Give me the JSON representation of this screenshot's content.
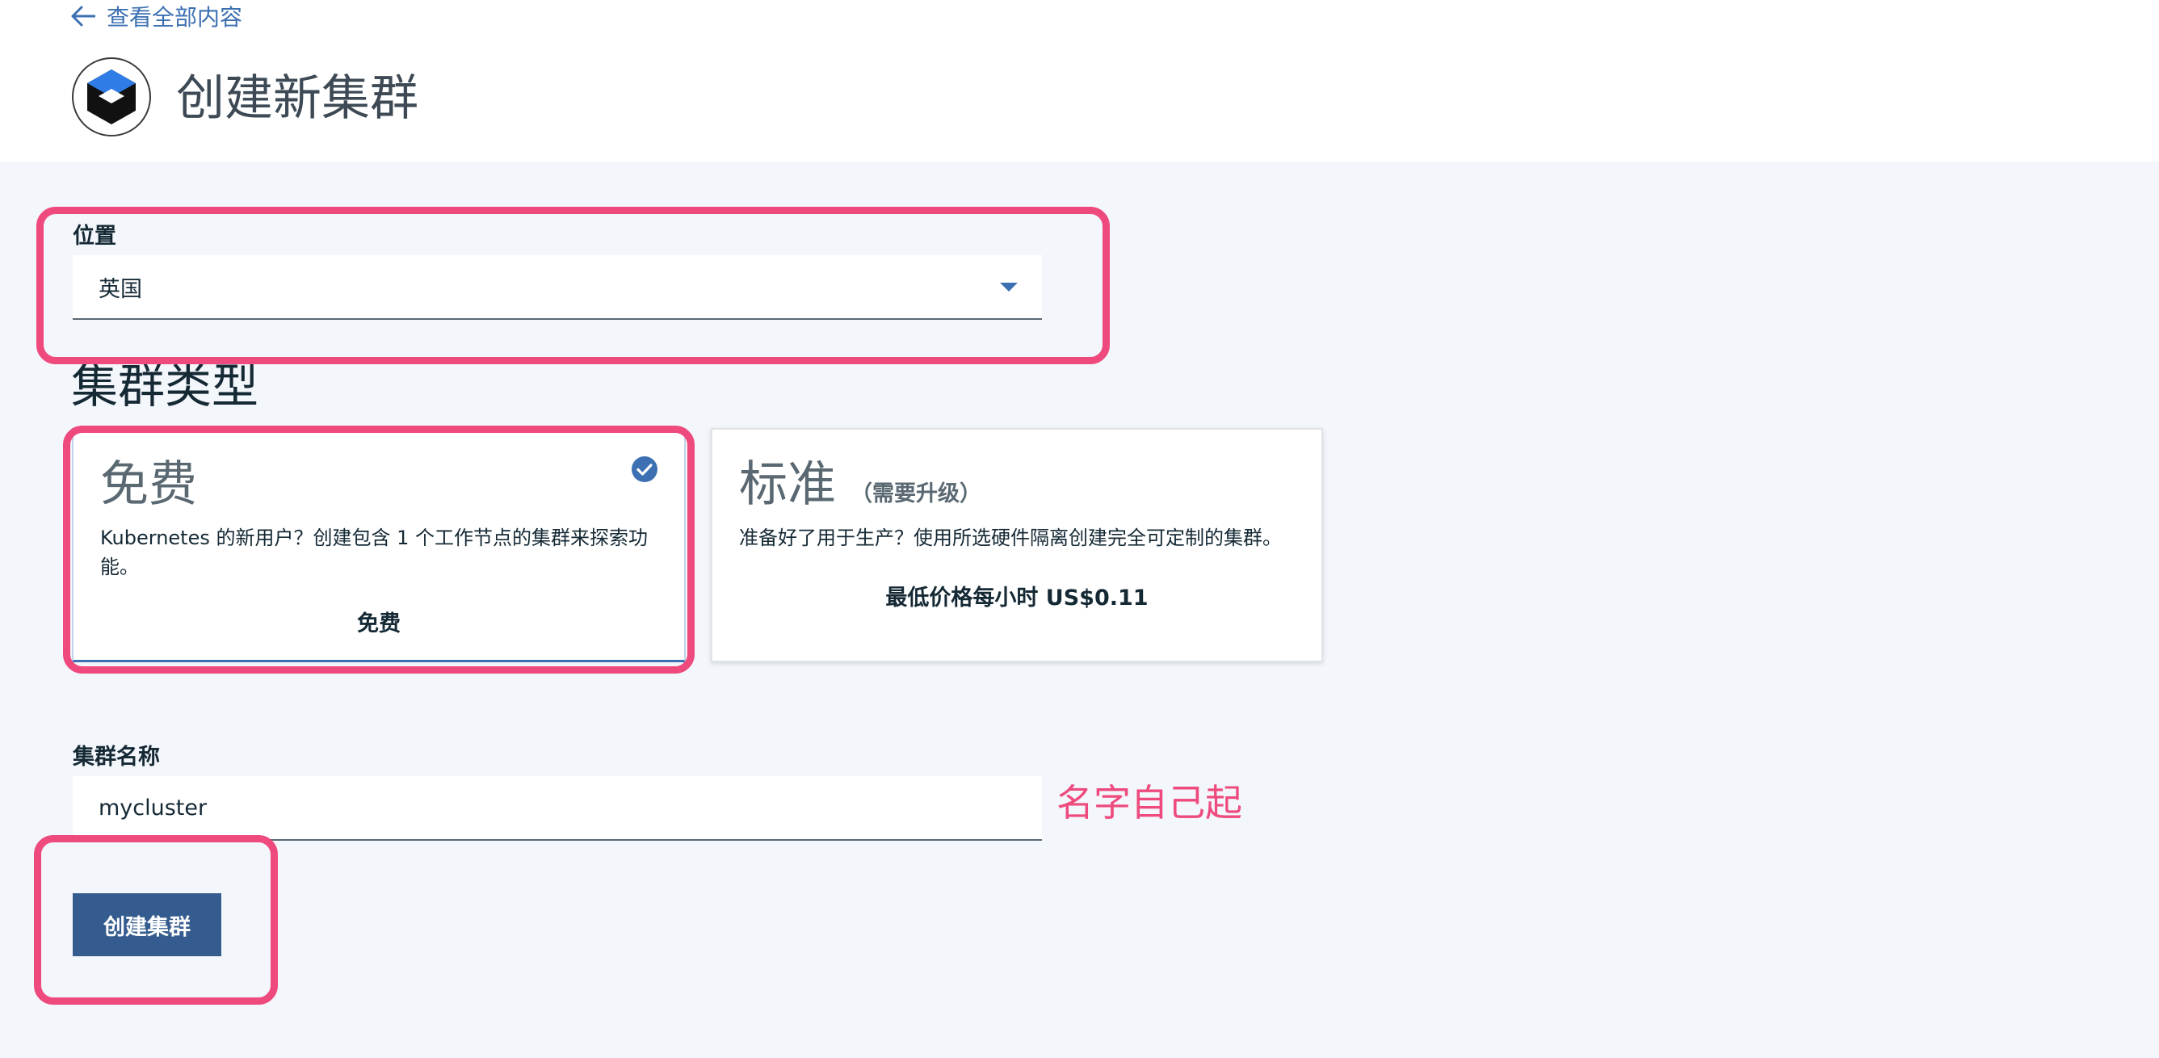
{
  "header": {
    "back_label": "查看全部内容",
    "title": "创建新集群"
  },
  "location": {
    "label": "位置",
    "value": "英国"
  },
  "cluster_type": {
    "heading": "集群类型",
    "free": {
      "title": "免费",
      "description": "Kubernetes 的新用户？创建包含 1 个工作节点的集群来探索功能。",
      "price": "免费",
      "selected": true
    },
    "standard": {
      "title": "标准",
      "subtitle": "（需要升级）",
      "description": "准备好了用于生产？使用所选硬件隔离创建完全可定制的集群。",
      "price": "最低价格每小时 US$0.11"
    }
  },
  "cluster_name": {
    "label": "集群名称",
    "value": "mycluster"
  },
  "annotation": {
    "text": "名字自己起",
    "color": "#ee4a7d"
  },
  "create_button": {
    "label": "创建集群"
  },
  "colors": {
    "accent": "#3d70b2",
    "primary_button": "#355c8e",
    "highlight": "#ee4a7d",
    "background": "#f3f6fb"
  }
}
